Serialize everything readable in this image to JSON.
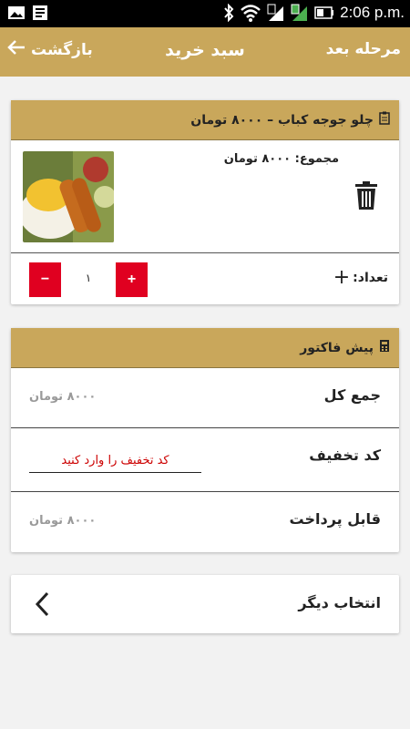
{
  "status_bar": {
    "time": "2:06 p.m."
  },
  "app_bar": {
    "next_label": "مرحله بعد",
    "title": "سبد خرید",
    "back_label": "بازگشت"
  },
  "cart_item": {
    "name_price": "چلو جوجه کباب – ۸۰۰۰ تومان",
    "total": "مجموع: ۸۰۰۰ تومان",
    "quantity_label": "تعداد:",
    "quantity_value": "۱",
    "minus_label": "−",
    "plus_label": "+"
  },
  "invoice": {
    "title": "پیش فاکتور",
    "rows": {
      "total_label": "جمع کل",
      "total_value": "۸۰۰۰ تومان",
      "discount_label": "کد تخفیف",
      "discount_placeholder": "کد تخفیف را وارد کنید",
      "payable_label": "قابل پرداخت",
      "payable_value": "۸۰۰۰ تومان"
    }
  },
  "select_other": {
    "label": "انتخاب دیگر"
  },
  "icons": {
    "clipboard": "clipboard-icon",
    "calculator": "calculator-icon",
    "trash": "trash-icon",
    "back": "arrow-left-icon",
    "chevron": "chevron-left-icon"
  },
  "colors": {
    "accent": "#c9a75b",
    "danger": "#e00020",
    "muted": "#9a9a9a"
  }
}
